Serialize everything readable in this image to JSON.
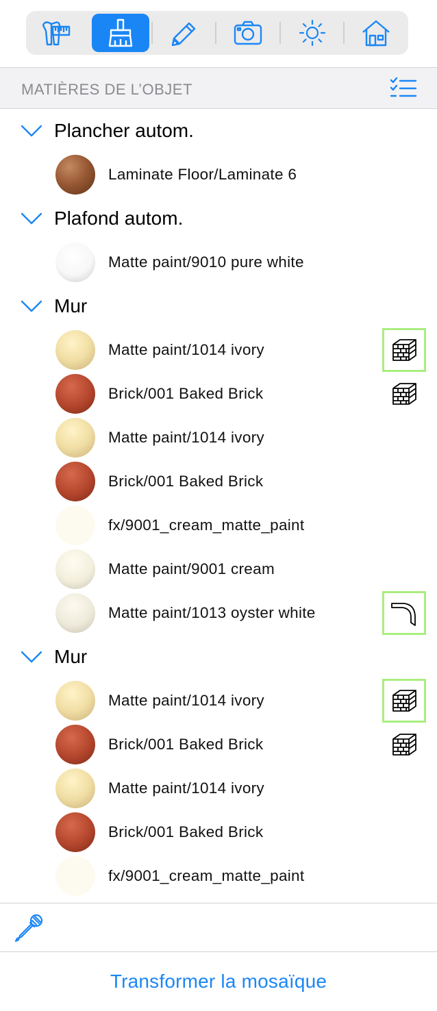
{
  "toolbar": {
    "buttons": [
      {
        "name": "measure-tool-icon",
        "active": false
      },
      {
        "name": "paint-brush-icon",
        "active": true
      },
      {
        "name": "pencil-icon",
        "active": false
      },
      {
        "name": "camera-icon",
        "active": false
      },
      {
        "name": "sun-icon",
        "active": false
      },
      {
        "name": "house-icon",
        "active": false
      }
    ]
  },
  "section": {
    "title": "MATIÈRES DE L’OBJET",
    "icon": "checklist-icon"
  },
  "groups": [
    {
      "label": "Plancher autom.",
      "items": [
        {
          "label": "Laminate Floor/Laminate 6",
          "swatch": "wood",
          "icon": null,
          "selected": false
        }
      ]
    },
    {
      "label": "Plafond autom.",
      "items": [
        {
          "label": "Matte paint/9010 pure white",
          "swatch": "white",
          "icon": null,
          "selected": false
        }
      ]
    },
    {
      "label": "Mur",
      "items": [
        {
          "label": "Matte paint/1014 ivory",
          "swatch": "ivory",
          "icon": "brick-wall-icon",
          "selected": true
        },
        {
          "label": "Brick/001 Baked Brick",
          "swatch": "brick",
          "icon": "brick-wall-icon",
          "selected": false
        },
        {
          "label": "Matte paint/1014 ivory",
          "swatch": "ivory",
          "icon": null,
          "selected": false
        },
        {
          "label": "Brick/001 Baked Brick",
          "swatch": "brick",
          "icon": null,
          "selected": false
        },
        {
          "label": "fx/9001_cream_matte_paint",
          "swatch": "cream-flat",
          "icon": null,
          "selected": false
        },
        {
          "label": "Matte paint/9001 cream",
          "swatch": "cream",
          "icon": null,
          "selected": false
        },
        {
          "label": "Matte paint/1013 oyster white",
          "swatch": "oyster",
          "icon": "corner-molding-icon",
          "selected": true
        }
      ]
    },
    {
      "label": "Mur",
      "items": [
        {
          "label": "Matte paint/1014 ivory",
          "swatch": "ivory",
          "icon": "brick-wall-icon",
          "selected": true
        },
        {
          "label": "Brick/001 Baked Brick",
          "swatch": "brick",
          "icon": "brick-wall-icon",
          "selected": false
        },
        {
          "label": "Matte paint/1014 ivory",
          "swatch": "ivory",
          "icon": null,
          "selected": false
        },
        {
          "label": "Brick/001 Baked Brick",
          "swatch": "brick",
          "icon": null,
          "selected": false
        },
        {
          "label": "fx/9001_cream_matte_paint",
          "swatch": "cream-flat",
          "icon": null,
          "selected": false
        }
      ]
    }
  ],
  "bottom": {
    "tool_icon": "eyedropper-icon",
    "action_label": "Transformer la mosaïque"
  },
  "colors": {
    "accent": "#1a86f5",
    "selection": "#a9ee7e",
    "header_bg": "#f2f2f4",
    "header_text": "#8a8a8f"
  }
}
